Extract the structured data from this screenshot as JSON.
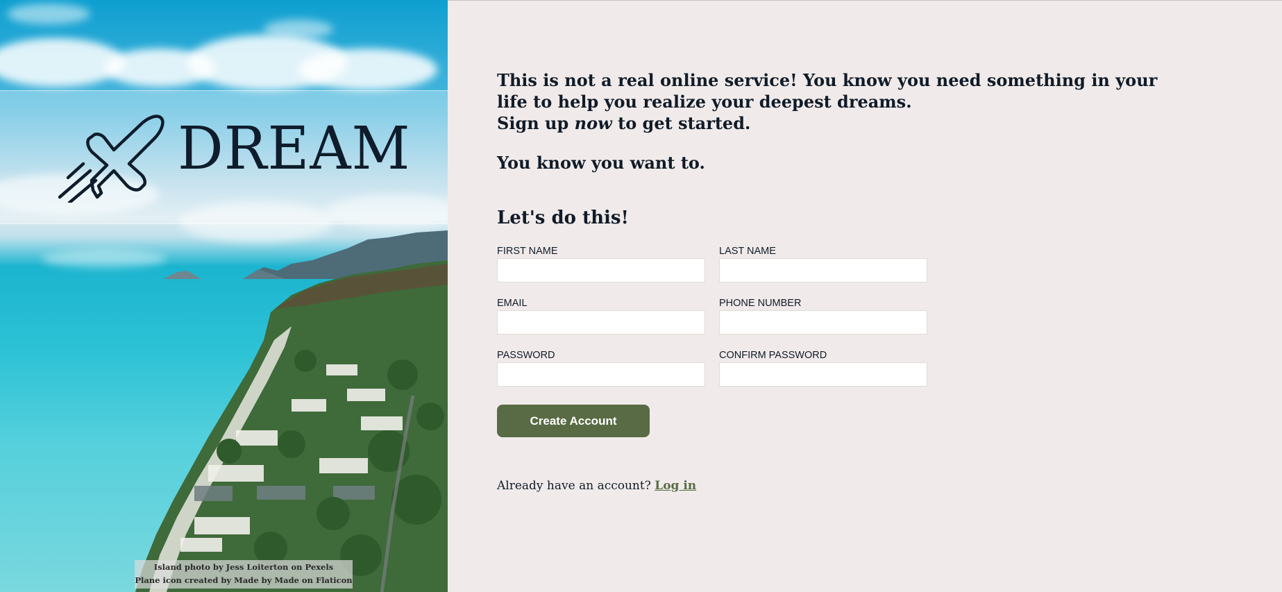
{
  "hero": {
    "logo_text": "DREAM",
    "credit_photo": "Island photo by Jess Loiterton on Pexels",
    "credit_icon": "Plane icon created by Made by Made on Flaticon"
  },
  "intro": {
    "line1": "This is not a real online service! You know you need something in your life to help you realize your deepest dreams.",
    "line2_before": "Sign up ",
    "line2_em": "now",
    "line2_after": " to get started.",
    "tagline": "You know you want to."
  },
  "form": {
    "title": "Let's do this!",
    "first_name_label": "FIRST NAME",
    "first_name_value": "",
    "last_name_label": "LAST NAME",
    "last_name_value": "",
    "email_label": "EMAIL",
    "email_value": "",
    "phone_label": "PHONE NUMBER",
    "phone_value": "",
    "password_label": "PASSWORD",
    "password_value": "",
    "confirm_password_label": "CONFIRM PASSWORD",
    "confirm_password_value": "",
    "submit_label": "Create Account"
  },
  "login": {
    "prompt": "Already have an account?",
    "link_label": "Log in"
  },
  "colors": {
    "background": "#f0ebea",
    "accent": "#596b45",
    "text": "#111b28"
  }
}
